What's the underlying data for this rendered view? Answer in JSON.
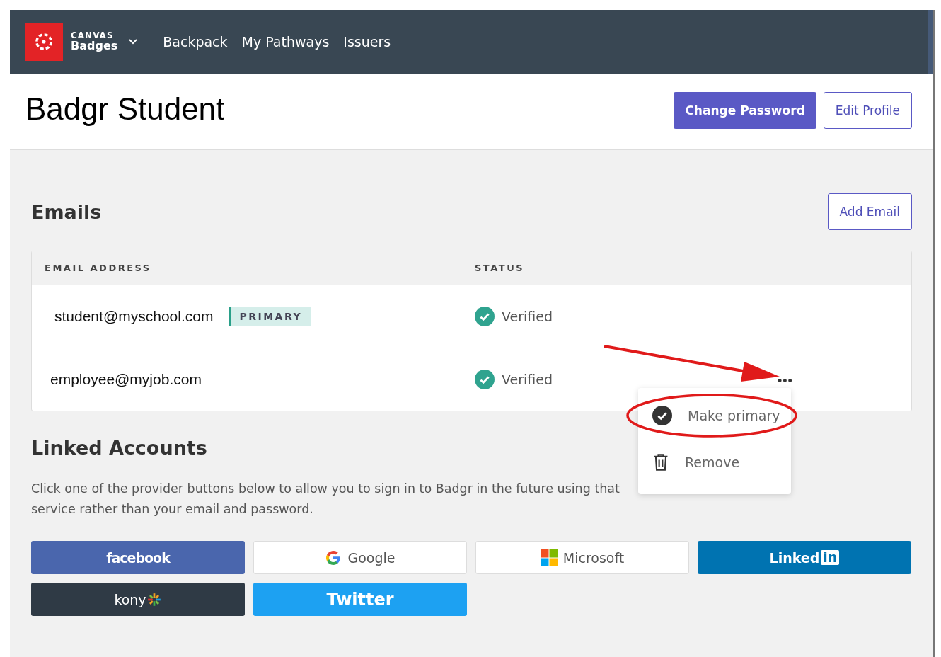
{
  "nav": {
    "brand_top": "CANVAS",
    "brand_bottom": "Badges",
    "links": [
      "Backpack",
      "My Pathways",
      "Issuers"
    ]
  },
  "profile": {
    "name": "Badgr Student",
    "buttons": [
      {
        "label": "Change Password",
        "kind": "primary"
      },
      {
        "label": "Edit Profile",
        "kind": "outline"
      }
    ]
  },
  "emails": {
    "title": "Emails",
    "add_button": "Add Email",
    "columns": [
      "EMAIL ADDRESS",
      "STATUS"
    ],
    "rows": [
      {
        "address": "student@myschool.com",
        "badge": "PRIMARY",
        "status": "Verified"
      },
      {
        "address": "employee@myjob.com",
        "status": "Verified",
        "actions": "•••"
      }
    ]
  },
  "menu": {
    "items": [
      {
        "label": "Make primary",
        "kind": "check",
        "highlighted": true
      },
      {
        "label": "Remove",
        "kind": "trash",
        "highlighted": false
      }
    ]
  },
  "linked": {
    "title": "Linked Accounts",
    "description": "Click one of the provider buttons below to allow you to sign in to Badgr in the future using that service rather than your email and password.",
    "providers": [
      {
        "kind": "facebook",
        "label": "facebook"
      },
      {
        "kind": "google",
        "label": "Google"
      },
      {
        "kind": "microsoft",
        "label": "Microsoft"
      },
      {
        "kind": "linkedin",
        "label": "Linked",
        "badge": "in"
      },
      {
        "kind": "kony",
        "label": "kony"
      },
      {
        "kind": "twitter",
        "label": "Twitter"
      }
    ]
  }
}
